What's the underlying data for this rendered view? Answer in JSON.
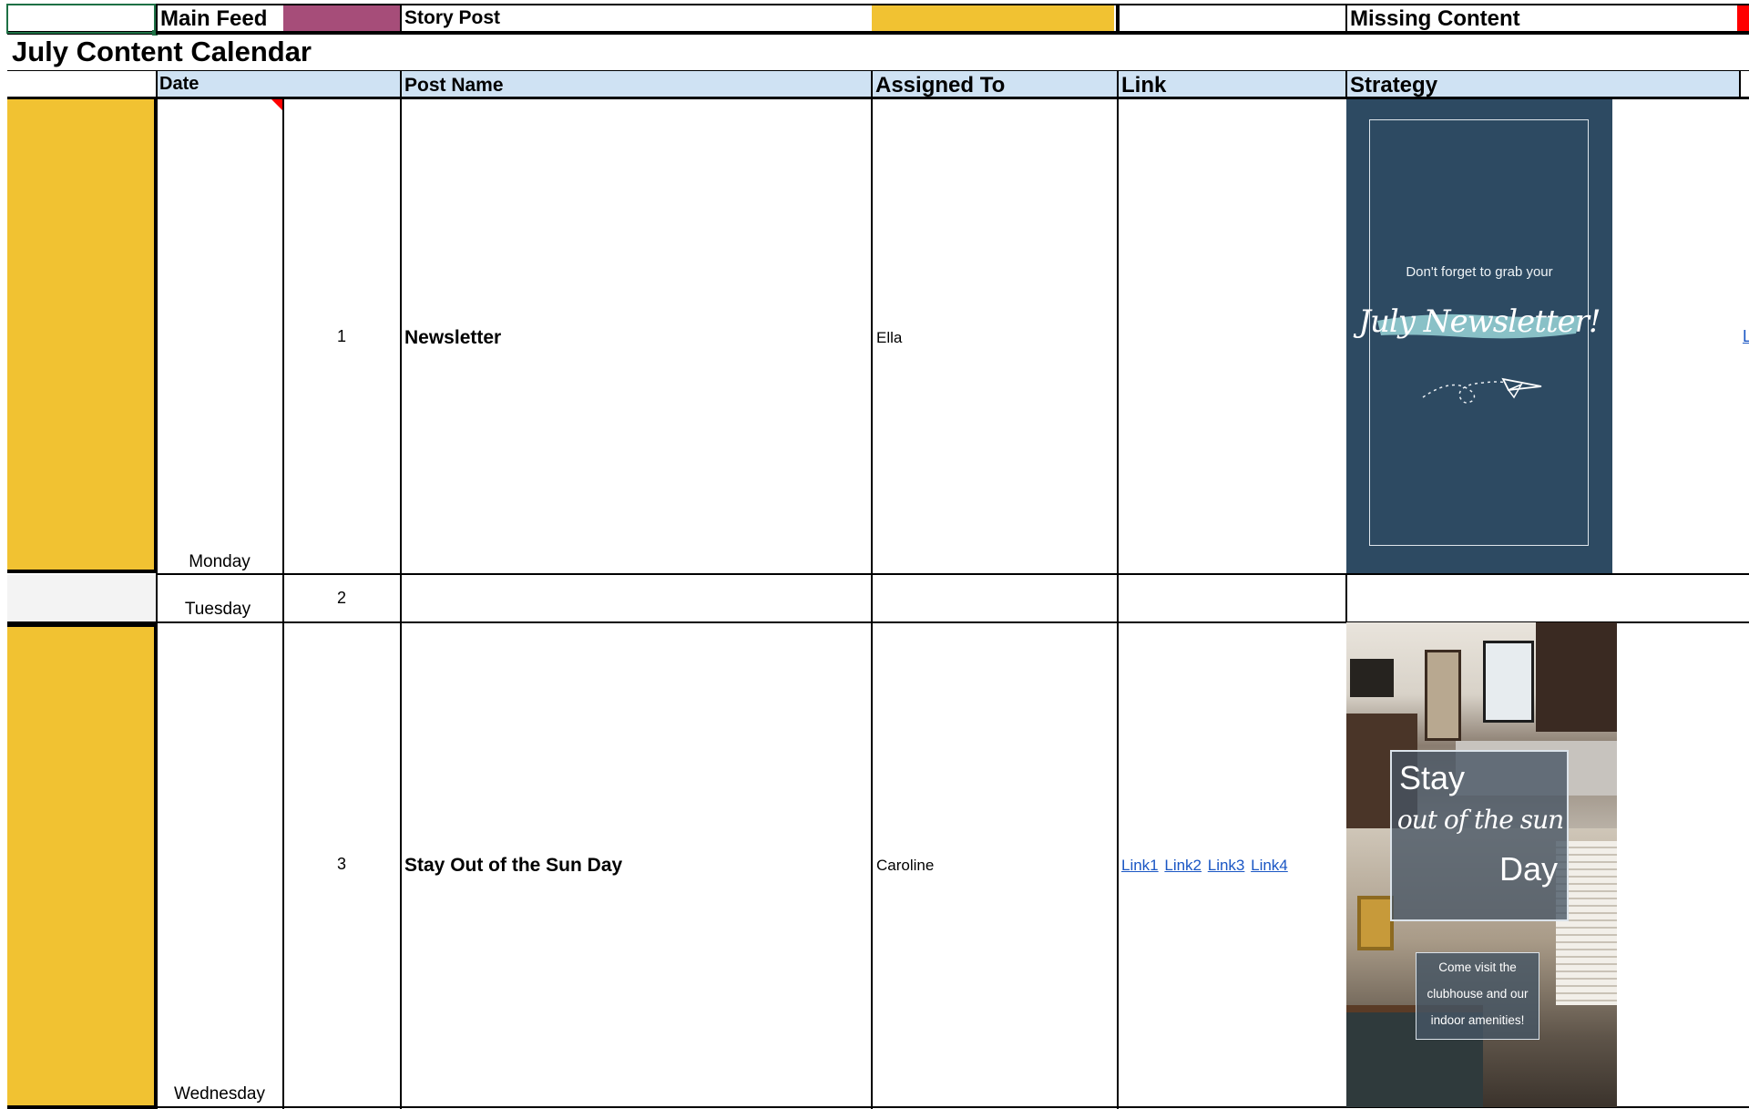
{
  "legend": {
    "main_feed_label": "Main Feed",
    "main_feed_color": "#a64d79",
    "story_post_label": "Story Post",
    "story_post_color": "#f1c232",
    "missing_content_label": "Missing Content",
    "missing_content_color": "#ff0000"
  },
  "title": "July Content Calendar",
  "headers": {
    "date": "Date",
    "post_name": "Post Name",
    "assigned_to": "Assigned To",
    "link": "Link",
    "strategy": "Strategy"
  },
  "colors": {
    "header_bg": "#cfe2f3",
    "story_yellow": "#f1c232",
    "grey_cell": "#f3f3f3",
    "link_blue": "#1a56c4",
    "selected_cell_border": "#1e7145",
    "newsletter_bg": "#2d4a62"
  },
  "rows": [
    {
      "weekday": "Monday",
      "day": "1",
      "post_name": "Newsletter",
      "assigned_to": "Ella",
      "strategy_image": {
        "line1": "Don't forget to grab your",
        "script": "July Newsletter!"
      }
    },
    {
      "weekday": "Tuesday",
      "day": "2",
      "post_name": "",
      "assigned_to": ""
    },
    {
      "weekday": "Wednesday",
      "day": "3",
      "post_name": "Stay Out of the Sun Day",
      "assigned_to": "Caroline",
      "links": [
        "Link1",
        "Link2",
        "Link3",
        "Link4"
      ],
      "strategy_image": {
        "stay": "Stay",
        "script": "out of the sun",
        "day": "Day",
        "caption_1": "Come visit the",
        "caption_2": "clubhouse and our",
        "caption_3": "indoor amenities!"
      }
    }
  ],
  "edge_fragment": "L"
}
